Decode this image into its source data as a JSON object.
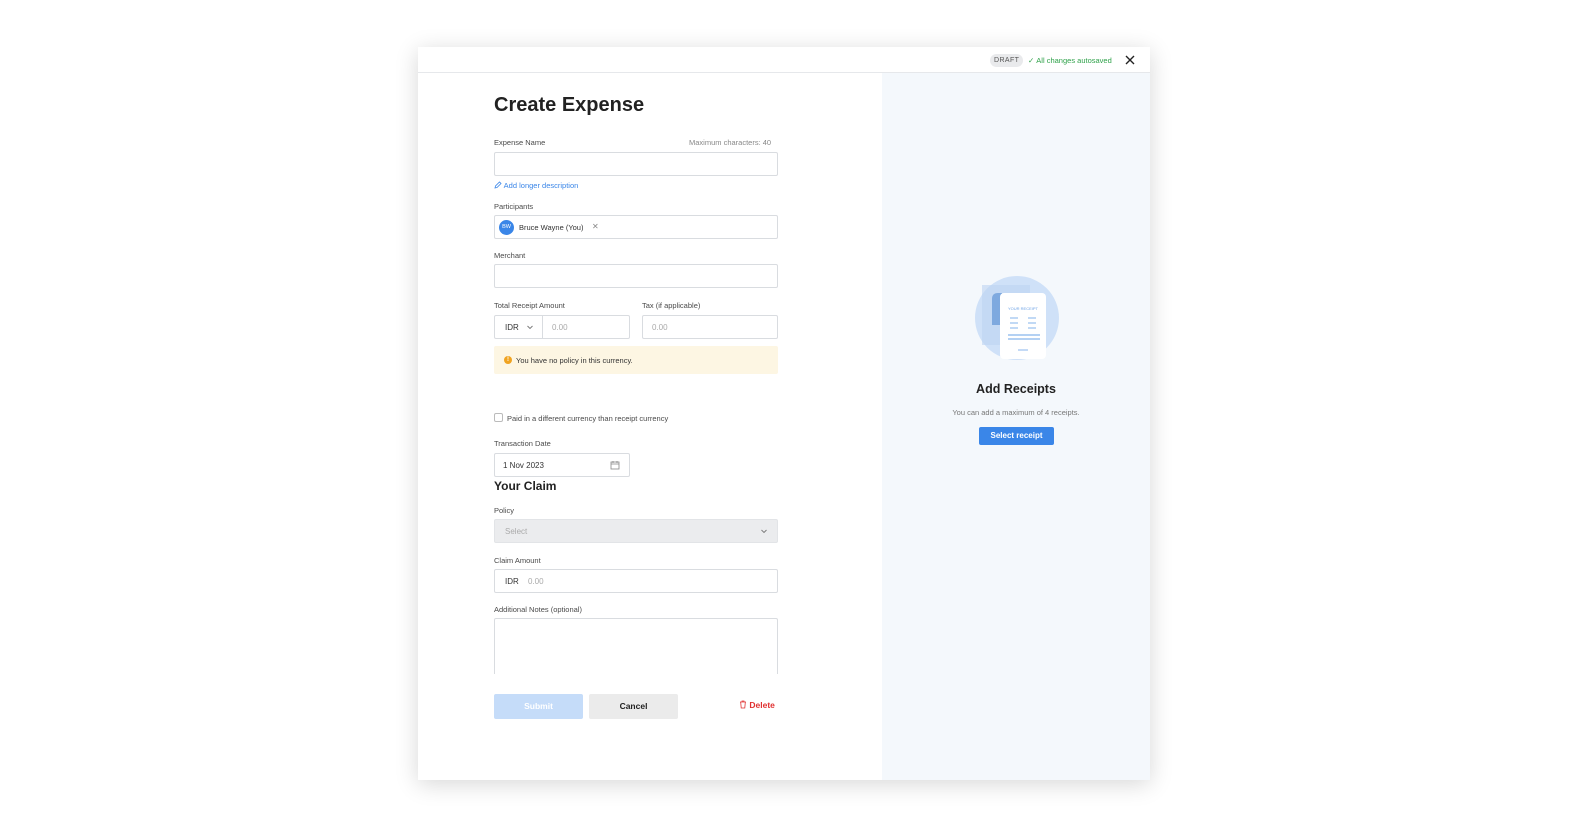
{
  "topbar": {
    "draft_badge": "DRAFT",
    "autosave_text": "All changes autosaved",
    "close_icon": "close-icon",
    "autosave_color": "#2fa24a"
  },
  "form": {
    "title": "Create Expense",
    "expense_name": {
      "label": "Expense Name",
      "hint": "Maximum characters: 40",
      "value": ""
    },
    "add_description_link": "Add longer description",
    "participants": {
      "label": "Participants",
      "chip_initials": "BW",
      "chip_name": "Bruce Wayne (You)"
    },
    "merchant": {
      "label": "Merchant",
      "value": ""
    },
    "total_receipt_amount": {
      "label": "Total Receipt Amount",
      "currency": "IDR",
      "placeholder": "0.00"
    },
    "tax": {
      "label": "Tax (if applicable)",
      "placeholder": "0.00"
    },
    "warning": "You have no policy in this currency.",
    "different_currency_checkbox": {
      "label": "Paid in a different currency than receipt currency",
      "checked": false
    },
    "transaction_date": {
      "label": "Transaction Date",
      "value": "1 Nov 2023"
    }
  },
  "claim": {
    "section_title": "Your Claim",
    "policy": {
      "label": "Policy",
      "placeholder": "Select"
    },
    "claim_amount": {
      "label": "Claim Amount",
      "currency": "IDR",
      "placeholder": "0.00"
    },
    "notes": {
      "label": "Additional Notes (optional)",
      "value": ""
    }
  },
  "actions": {
    "submit": "Submit",
    "cancel": "Cancel",
    "delete": "Delete"
  },
  "receipts": {
    "illustration_text": "YOUR RECEIPT",
    "title": "Add Receipts",
    "subtitle": "You can add a maximum of 4 receipts.",
    "select_button": "Select receipt"
  },
  "colors": {
    "accent": "#3a86e8",
    "danger": "#e03131",
    "warning_bg": "#fdf6e3",
    "panel_bg": "#f4f8fc"
  }
}
